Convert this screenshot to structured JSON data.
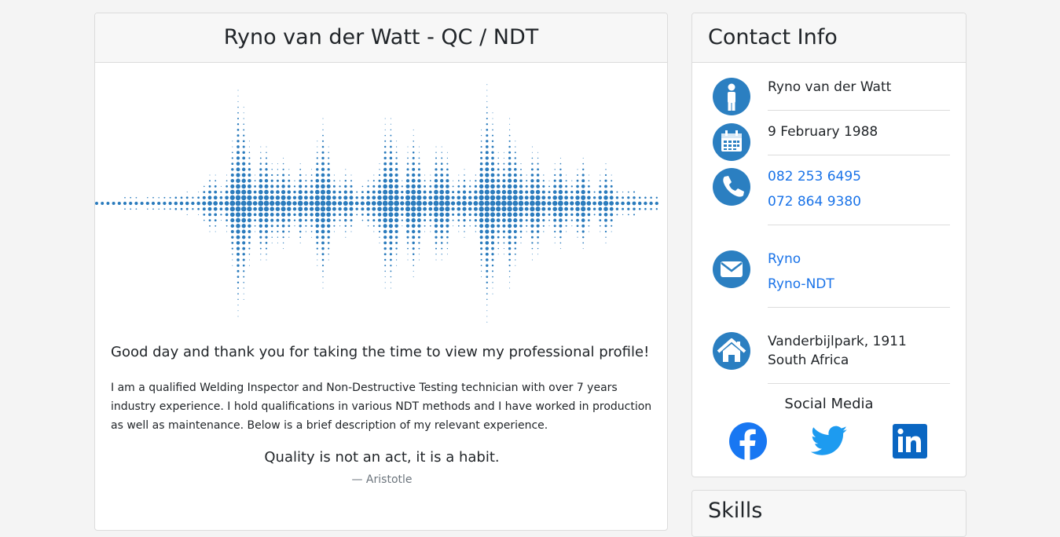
{
  "main": {
    "title": "Ryno van der Watt - QC / NDT",
    "greeting": "Good day and thank you for taking the time to view my professional profile!",
    "intro": "I am a qualified Welding Inspector and Non-Destructive Testing technician with over 7 years industry experience. I hold qualifications in various NDT methods and I have worked in production as well as maintenance. Below is a brief description of my relevant experience.",
    "quote": "Quality is not an act, it is a habit.",
    "quote_author": "— Aristotle",
    "waveform_color": "#2a7bbd"
  },
  "contact": {
    "title": "Contact Info",
    "name": "Ryno van der Watt",
    "birthday": "9 February 1988",
    "phone_1": "082 253 6495",
    "phone_2": "072 864 9380",
    "email_1": "Ryno",
    "email_2": "Ryno-NDT",
    "address_line_1": "Vanderbijlpark, 1911",
    "address_line_2": "South Africa",
    "social_title": "Social Media",
    "icon_color": "#2b7fc1",
    "link_color": "#1a73e8",
    "social_color": "#1877f2"
  },
  "skills": {
    "title": "Skills"
  }
}
